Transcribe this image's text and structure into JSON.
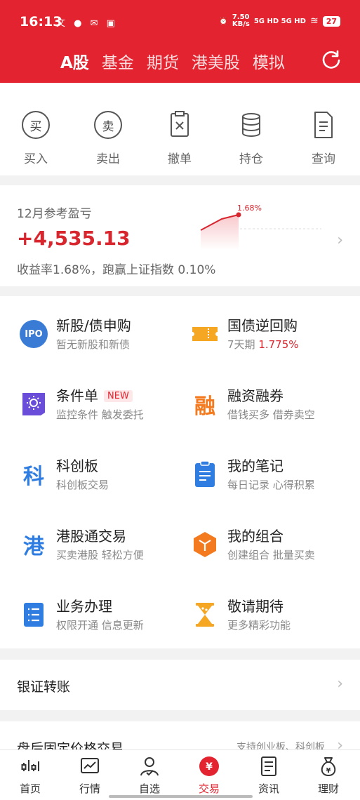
{
  "status": {
    "time": "16:13",
    "left_icons": "文 ● ✉ ▣",
    "net_speed": "7.50\nKB/s",
    "signal": "5G HD 5G HD",
    "battery": "27"
  },
  "header": {
    "tabs": [
      {
        "label": "A股",
        "active": true
      },
      {
        "label": "基金",
        "active": false
      },
      {
        "label": "期货",
        "active": false
      },
      {
        "label": "港美股",
        "active": false
      },
      {
        "label": "模拟",
        "active": false
      }
    ]
  },
  "actions": [
    {
      "label": "买入",
      "glyph": "买",
      "icon": "buy-icon"
    },
    {
      "label": "卖出",
      "glyph": "卖",
      "icon": "sell-icon"
    },
    {
      "label": "撤单",
      "icon": "cancel-order-icon"
    },
    {
      "label": "持仓",
      "icon": "position-icon"
    },
    {
      "label": "查询",
      "icon": "query-icon"
    }
  ],
  "pnl": {
    "title": "12月参考盈亏",
    "value": "+4,535.13",
    "subtitle": "收益率1.68%，跑赢上证指数 0.10%",
    "chart_label": "1.68%"
  },
  "services": [
    {
      "title": "新股/债申购",
      "sub": "暂无新股和新债",
      "icon": "ipo-icon",
      "glyph": "IPO"
    },
    {
      "title": "国债逆回购",
      "sub_prefix": "7天期 ",
      "sub_rate": "1.775%",
      "icon": "ticket-icon"
    },
    {
      "title": "条件单",
      "badge": "NEW",
      "sub": "监控条件 触发委托",
      "icon": "condition-order-icon"
    },
    {
      "title": "融资融券",
      "sub": "借钱买多 借券卖空",
      "icon": "margin-icon",
      "glyph": "融"
    },
    {
      "title": "科创板",
      "sub": "科创板交易",
      "icon": "star-market-icon",
      "glyph": "科"
    },
    {
      "title": "我的笔记",
      "sub": "每日记录 心得积累",
      "icon": "notes-icon"
    },
    {
      "title": "港股通交易",
      "sub": "买卖港股 轻松方便",
      "icon": "hk-connect-icon",
      "glyph": "港"
    },
    {
      "title": "我的组合",
      "sub": "创建组合 批量买卖",
      "icon": "portfolio-icon"
    },
    {
      "title": "业务办理",
      "sub": "权限开通 信息更新",
      "icon": "business-icon"
    },
    {
      "title": "敬请期待",
      "sub": "更多精彩功能",
      "icon": "hourglass-icon"
    }
  ],
  "rows": {
    "transfer": "银证转账",
    "fixed_price": "盘后固定价格交易",
    "fixed_price_right": "支持创业板、科创板"
  },
  "tabbar": [
    {
      "label": "首页",
      "icon": "home-icon",
      "active": false
    },
    {
      "label": "行情",
      "icon": "market-icon",
      "active": false
    },
    {
      "label": "自选",
      "icon": "watchlist-icon",
      "active": false
    },
    {
      "label": "交易",
      "icon": "trade-icon",
      "active": true
    },
    {
      "label": "资讯",
      "icon": "news-icon",
      "active": false
    },
    {
      "label": "理财",
      "icon": "wealth-icon",
      "active": false
    }
  ],
  "colors": {
    "brand": "#e3232f",
    "gain": "#d8262f"
  }
}
